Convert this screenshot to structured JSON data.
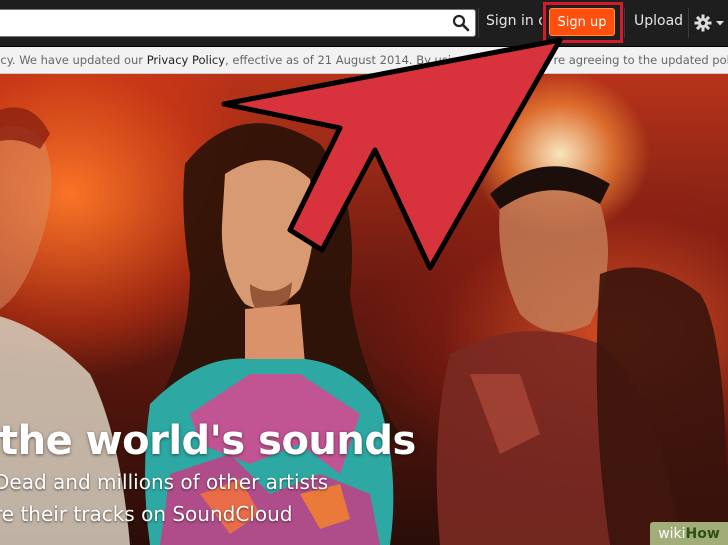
{
  "header": {
    "search": {
      "value": "",
      "placeholder": ""
    },
    "signin_label": "Sign in o",
    "signup_label": "Sign up",
    "upload_label": "Upload"
  },
  "notice": {
    "prefix": "licy. We have updated our ",
    "link": "Privacy Policy",
    "suffix": ", effective as of 21 August 2014. By using ou",
    "tail": "ou're agreeing to the updated policy."
  },
  "hero": {
    "headline": "the world's sounds",
    "sub1": "Dead and millions of other artists",
    "sub2": "re their tracks on SoundCloud"
  },
  "watermark": {
    "part1": "wiki",
    "part2": "How"
  },
  "colors": {
    "accent": "#ff4f0c",
    "highlight": "#d21b2b",
    "topbar": "#1e1e1e"
  },
  "icons": {
    "search": "search-icon",
    "settings": "gear-icon",
    "caret": "chevron-down-icon"
  }
}
